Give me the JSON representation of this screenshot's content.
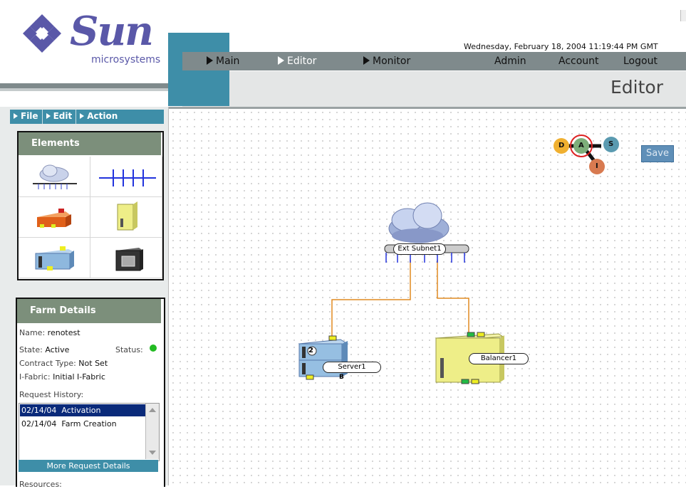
{
  "brand": {
    "name": "Sun",
    "subtitle": "microsystems"
  },
  "header": {
    "datetime": "Wednesday, February 18, 2004 11:19:44 PM GMT",
    "nav": [
      {
        "label": "Main"
      },
      {
        "label": "Editor"
      },
      {
        "label": "Monitor"
      },
      {
        "label": "Admin"
      },
      {
        "label": "Account"
      },
      {
        "label": "Logout"
      }
    ],
    "page_title": "Editor"
  },
  "menu": {
    "file": "File",
    "edit": "Edit",
    "action": "Action"
  },
  "elements_panel": {
    "title": "Elements",
    "items": [
      "subnet-cloud",
      "vlan-bus",
      "firewall-device",
      "load-balancer-device",
      "server-device",
      "storage-device"
    ]
  },
  "farm_details": {
    "title": "Farm Details",
    "name_label": "Name:",
    "name_value": "renotest",
    "state_label": "State:",
    "state_value": "Active",
    "status_label": "Status:",
    "status_color": "#22bb22",
    "contract_label": "Contract Type:",
    "contract_value": "Not Set",
    "ifabric_label": "I-Fabric:",
    "ifabric_value": "Initial I-Fabric",
    "history_label": "Request History:",
    "history": [
      {
        "date": "02/14/04",
        "action": "Activation",
        "selected": true
      },
      {
        "date": "02/14/04",
        "action": "Farm Creation",
        "selected": false
      }
    ],
    "more_button": "More Request Details",
    "resources_label": "Resources:"
  },
  "canvas": {
    "save_button": "Save",
    "badges": {
      "d": "D",
      "a": "A",
      "s": "S",
      "i": "I"
    },
    "subnet": {
      "label": "Ext Subnet1"
    },
    "server": {
      "label": "Server1",
      "count": "2",
      "tag": "B"
    },
    "balancer": {
      "label": "Balancer1"
    }
  },
  "colors": {
    "accent": "#3e8ea8",
    "header_gray": "#7f8a8c",
    "panel_header": "#7c8f7b",
    "selection": "#0a2a7a",
    "link_line": "#e08a20"
  }
}
